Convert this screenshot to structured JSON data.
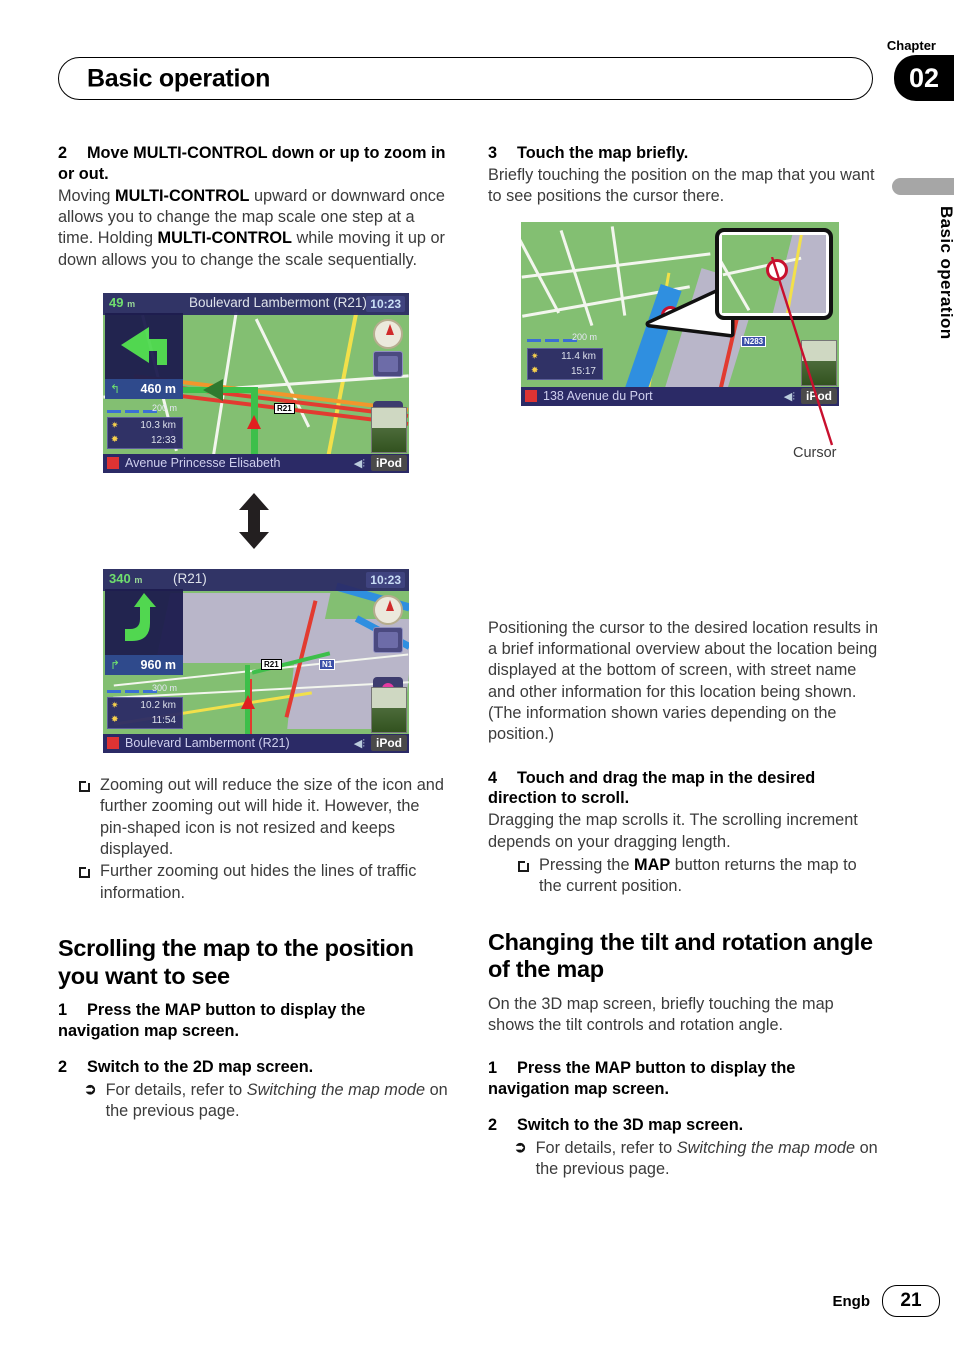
{
  "header": {
    "chapter_label": "Chapter",
    "chapter_number": "02",
    "title": "Basic operation"
  },
  "side_tab": {
    "text": "Basic operation"
  },
  "footer": {
    "language": "Engb",
    "page_number": "21"
  },
  "left_column": {
    "step2": {
      "number": "2",
      "heading": "Move MULTI-CONTROL down or up to zoom in or out.",
      "body_parts": [
        {
          "text": "Moving ",
          "bold": false
        },
        {
          "text": "MULTI-CONTROL",
          "bold": true
        },
        {
          "text": " upward or downward once allows you to change the map scale one step at a time. Holding ",
          "bold": false
        },
        {
          "text": "MULTI-CONTROL",
          "bold": true
        },
        {
          "text": " while moving it up or down allows you to change the scale sequentially.",
          "bold": false
        }
      ]
    },
    "map_screenshot_zoomed_in": {
      "distance": "49",
      "distance_unit": "m",
      "street_name": "Boulevard Lambermont (R21)",
      "clock": "10:23",
      "next_turn_distance": "460 m",
      "route_label": "R21",
      "trip_distance": "10.3 km",
      "arrival_time": "12:33",
      "scale": "200 m",
      "bottom_street": "Avenue Princesse Elisabeth",
      "source_button": "iPod"
    },
    "arrow_icon": "double-arrow-up-down",
    "map_screenshot_zoomed_out": {
      "distance": "340",
      "distance_unit": "m",
      "street_name": "(R21)",
      "clock": "10:23",
      "next_turn_distance": "960 m",
      "route_label": "R21",
      "secondary_route_label": "N1",
      "trip_distance": "10.2 km",
      "arrival_time": "11:54",
      "scale": "300 m",
      "bottom_street": "Boulevard Lambermont (R21)",
      "source_button": "iPod"
    },
    "notes": [
      "Zooming out will reduce the size of the icon and further zooming out will hide it. However, the pin-shaped icon is not resized and keeps displayed.",
      "Further zooming out hides the lines of traffic information."
    ],
    "section_heading": "Scrolling the map to the position you want to see",
    "step1": {
      "number": "1",
      "heading": "Press the MAP button to display the navigation map screen."
    },
    "step2b": {
      "number": "2",
      "heading": "Switch to the 2D map screen.",
      "sub_glyph": "⮑",
      "sub_text_before": "For details, refer to ",
      "sub_text_italic": "Switching the map mode",
      "sub_text_after": " on the previous page."
    }
  },
  "right_column": {
    "step3": {
      "number": "3",
      "heading": "Touch the map briefly.",
      "body": "Briefly touching the position on the map that you want to see positions the cursor there."
    },
    "map_screenshot_cursor": {
      "scale": "200 m",
      "trip_distance": "11.4 km",
      "arrival_time": "15:17",
      "bottom_street": "138 Avenue du Port",
      "source_button": "iPod",
      "route_label": "N283",
      "callout_label": "magnified-cursor-view"
    },
    "cursor_caption": "Cursor",
    "paragraph": "Positioning the cursor to the desired location results in a brief informational overview about the location being displayed at the bottom of screen, with street name and other information for this location being shown. (The information shown varies depending on the position.)",
    "step4": {
      "number": "4",
      "heading": "Touch and drag the map in the desired direction to scroll.",
      "body_plain": "Dragging the map scrolls it. The scrolling increment depends on your dragging length.",
      "note_before": "Pressing the ",
      "note_bold": "MAP",
      "note_after": " button returns the map to the current position."
    },
    "section_heading": "Changing the tilt and rotation angle of the map",
    "section_body": "On the 3D map screen, briefly touching the map shows the tilt controls and rotation angle.",
    "step1": {
      "number": "1",
      "heading": "Press the MAP button to display the navigation map screen."
    },
    "step2": {
      "number": "2",
      "heading": "Switch to the 3D map screen.",
      "sub_glyph": "⮑",
      "sub_text_before": "For details, refer to ",
      "sub_text_italic": "Switching the map mode",
      "sub_text_after": " on the previous page."
    }
  },
  "colors": {
    "chapter_badge_bg": "#000000",
    "side_tab_bar": "#a6a6a6",
    "body_text": "#3b3b3b",
    "cursor_line": "#c8102e"
  }
}
